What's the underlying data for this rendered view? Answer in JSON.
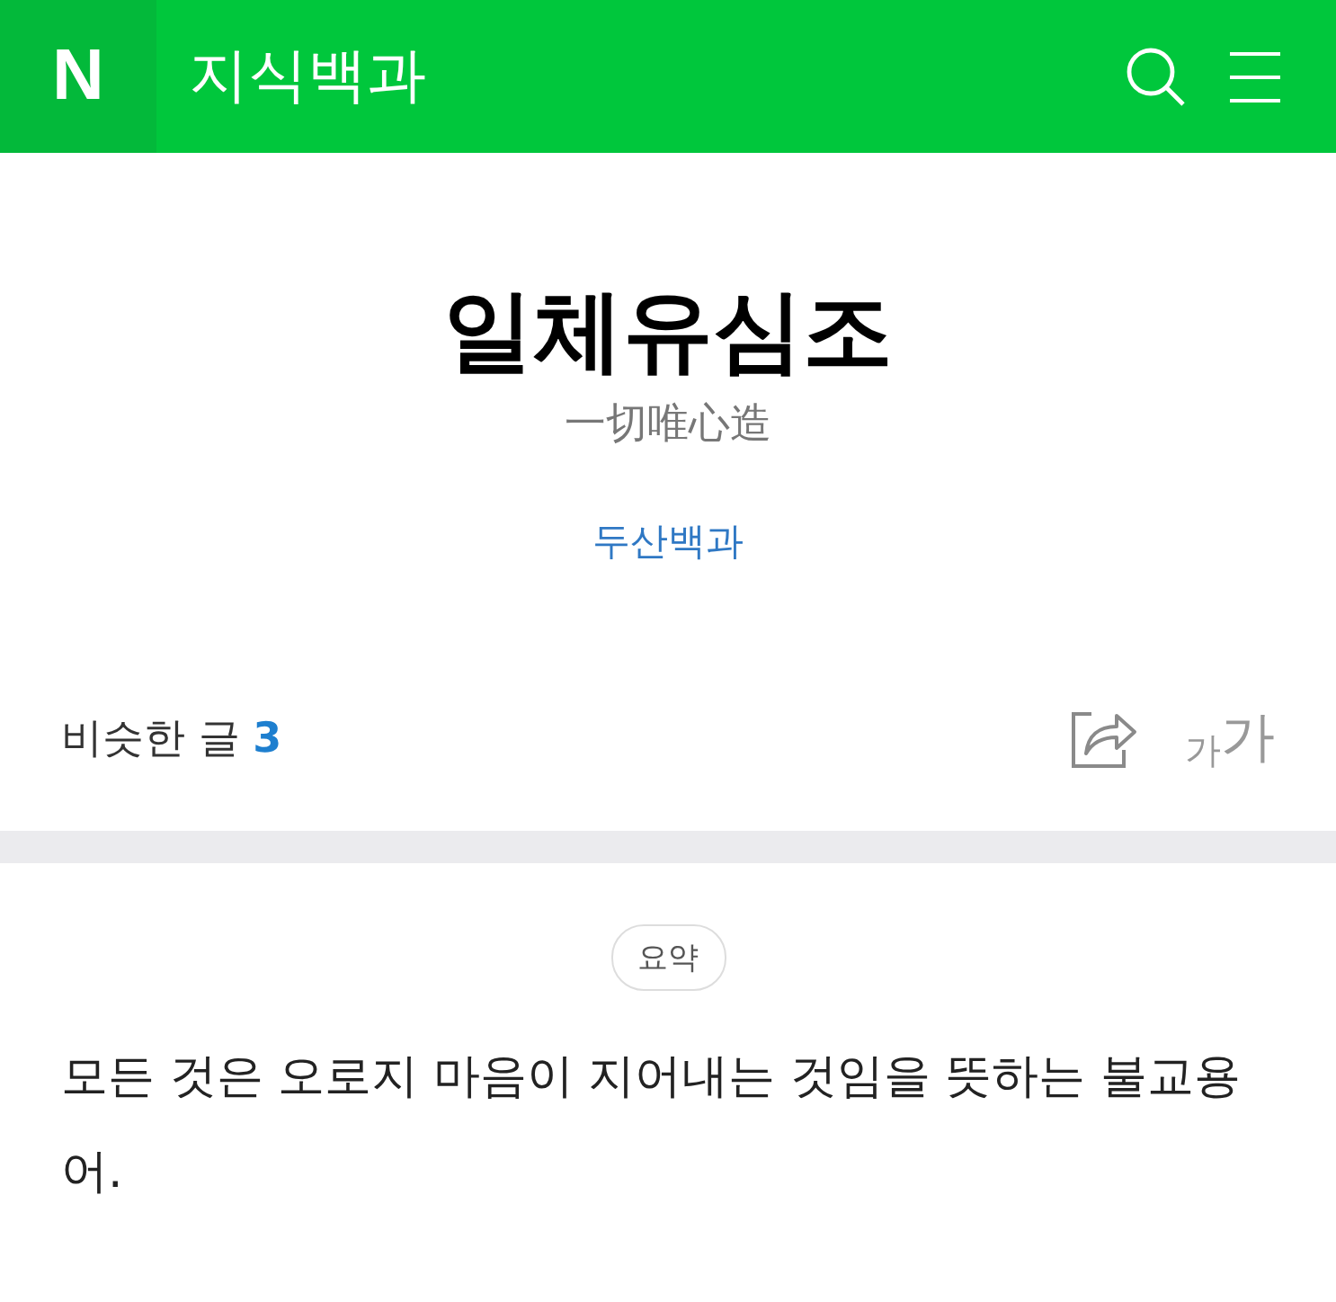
{
  "header": {
    "logo": "N",
    "title": "지식백과"
  },
  "entry": {
    "title": "일체유심조",
    "hanja": "一切唯心造",
    "source": "두산백과"
  },
  "related": {
    "label": "비슷한 글",
    "count": "3"
  },
  "font_size": {
    "small": "가",
    "large": "가"
  },
  "summary": {
    "badge": "요약",
    "text": "모든 것은 오로지 마음이 지어내는 것임을 뜻하는 불교용어."
  }
}
